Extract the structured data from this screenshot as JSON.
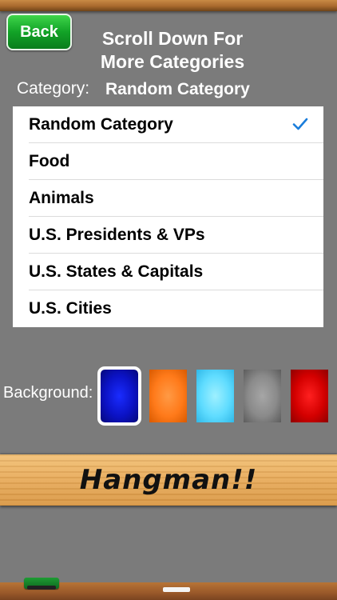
{
  "header": {
    "back_label": "Back",
    "title_line1": "Scroll Down For",
    "title_line2": "More Categories"
  },
  "category": {
    "label": "Category:",
    "selected": "Random Category"
  },
  "list": {
    "items": [
      {
        "label": "Random Category",
        "checked": true
      },
      {
        "label": "Food"
      },
      {
        "label": "Animals"
      },
      {
        "label": "U.S. Presidents & VPs"
      },
      {
        "label": "U.S. States & Capitals"
      },
      {
        "label": "U.S. Cities"
      }
    ],
    "check_icon": "checkmark-icon",
    "check_color": "#1a7ddb"
  },
  "background": {
    "label": "Background:",
    "swatches": [
      {
        "color": "#0b12c4",
        "selected": true
      },
      {
        "color": "#ff7a1a"
      },
      {
        "color": "#5fdcff"
      },
      {
        "color": "#8a8a8a"
      },
      {
        "color": "#d40000"
      }
    ]
  },
  "banner": {
    "text": "Hangman!!"
  },
  "icons": {
    "eraser": "eraser-icon",
    "chalk": "chalk-icon"
  }
}
